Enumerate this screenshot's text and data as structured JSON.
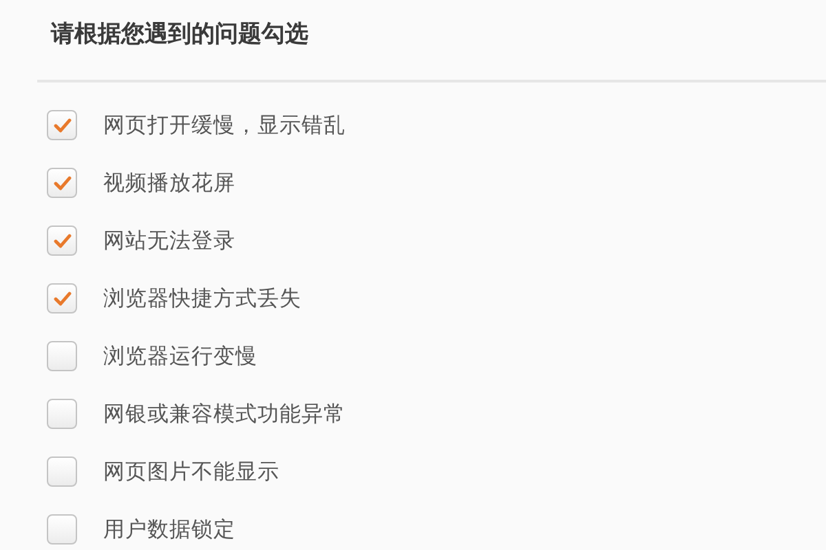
{
  "title": "请根据您遇到的问题勾选",
  "items": [
    {
      "label": "网页打开缓慢，显示错乱",
      "checked": true
    },
    {
      "label": "视频播放花屏",
      "checked": true
    },
    {
      "label": "网站无法登录",
      "checked": true
    },
    {
      "label": "浏览器快捷方式丢失",
      "checked": true
    },
    {
      "label": "浏览器运行变慢",
      "checked": false
    },
    {
      "label": "网银或兼容模式功能异常",
      "checked": false
    },
    {
      "label": "网页图片不能显示",
      "checked": false
    },
    {
      "label": "用户数据锁定",
      "checked": false
    }
  ]
}
